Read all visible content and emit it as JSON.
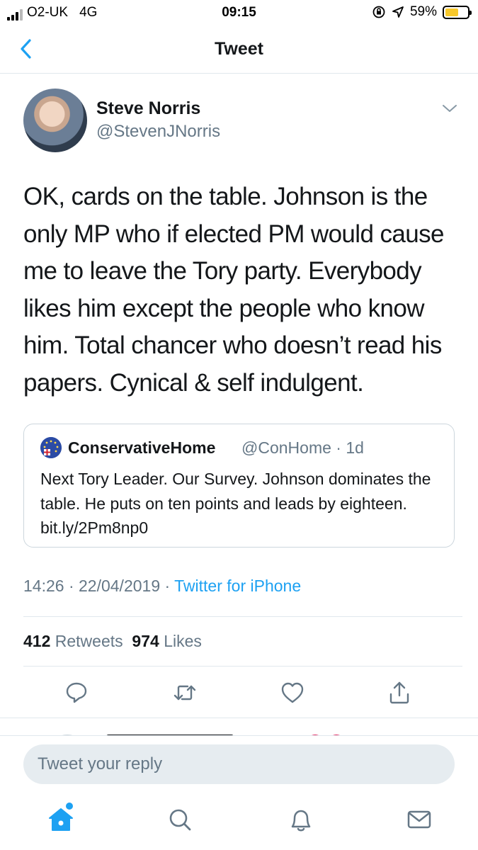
{
  "status_bar": {
    "carrier": "O2-UK",
    "network": "4G",
    "time": "09:15",
    "battery_percent_label": "59%",
    "battery_level": 0.59,
    "battery_color": "#f7c82b"
  },
  "nav": {
    "title": "Tweet",
    "back_icon": "chevron-left-icon"
  },
  "tweet": {
    "author_name": "Steve Norris",
    "author_handle": "@StevenJNorris",
    "text": "OK, cards on the table. Johnson is the only MP who if elected PM would cause me to leave the Tory party. Everybody likes him except the people who know him. Total chancer who doesn’t read his papers. Cynical & self indulgent.",
    "quoted": {
      "author_name": "ConservativeHome",
      "author_handle": "@ConHome · 1d",
      "text": "Next Tory Leader. Our Survey. Johnson dominates the table. He puts on ten points and leads by eighteen. bit.ly/2Pm8np0"
    },
    "timestamp": "14:26 · 22/04/2019 · ",
    "source": "Twitter for iPhone",
    "retweet_count": "412",
    "retweet_label": "Retweets",
    "like_count": "974",
    "like_label": "Likes"
  },
  "actions": [
    "reply-icon",
    "retweet-icon",
    "like-icon",
    "share-icon"
  ],
  "reply_bar": {
    "placeholder": "Tweet your reply"
  },
  "tab_bar": [
    "home-icon",
    "search-icon",
    "notifications-icon",
    "messages-icon"
  ],
  "colors": {
    "accent": "#1da1f2",
    "text": "#14171a",
    "secondary": "#657786",
    "border": "#e1e8ed"
  }
}
